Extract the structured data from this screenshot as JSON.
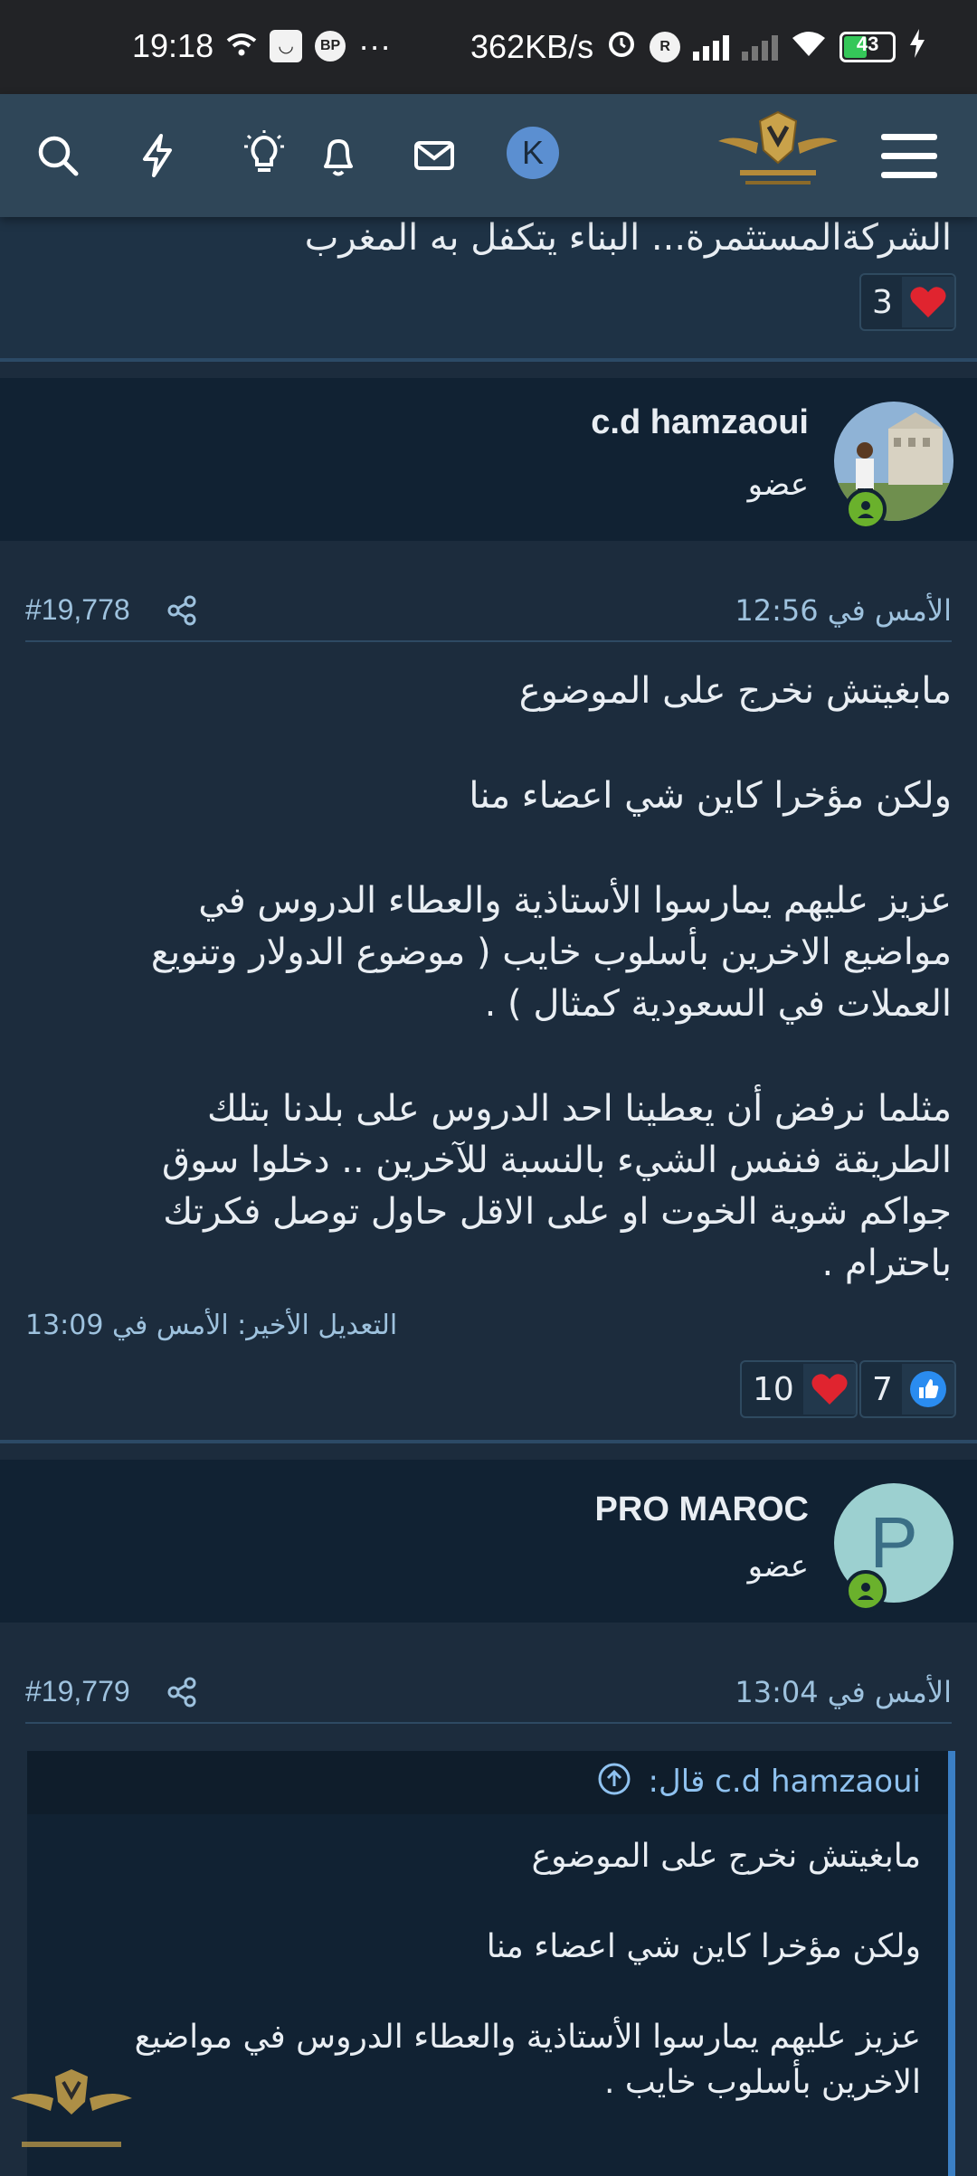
{
  "status_bar": {
    "time": "19:18",
    "bp": "BP",
    "dots": "···",
    "speed": "362KB/s",
    "r_icon": "R",
    "battery": "43"
  },
  "nav": {
    "avatar_letter": "K",
    "icons": [
      "search-icon",
      "lightning-icon",
      "lightbulb-icon",
      "bell-icon",
      "mail-icon",
      "menu-icon"
    ]
  },
  "prev_post": {
    "last_line": "الشركةالمستثمرة... البناء يتكفل به المغرب",
    "love_count": "3"
  },
  "post1": {
    "username": "c.d hamzaoui",
    "user_title": "عضو",
    "date": "الأمس في 12:56",
    "number": "#19,778",
    "lines": [
      "مابغيتش نخرج على الموضوع",
      "ولكن مؤخرا كاين شي اعضاء منا",
      "عزيز عليهم يمارسوا الأستاذية والعطاء الدروس في",
      "مواضيع الاخرين بأسلوب خايب ( موضوع الدولار وتنويع",
      "العملات في السعودية كمثال ) .",
      "مثلما نرفض أن يعطينا احد الدروس على بلدنا بتلك",
      "الطريقة فنفس الشيء بالنسبة للآخرين .. دخلوا سوق",
      "جواكم شوية الخوت او على الاقل حاول توصل فكرتك",
      "باحترام ."
    ],
    "edited": "التعديل الأخير: الأمس في 13:09",
    "like_count": "7",
    "love_count": "10"
  },
  "post2": {
    "username": "PRO MAROC",
    "avatar_letter": "P",
    "user_title": "عضو",
    "date": "الأمس في 13:04",
    "number": "#19,779",
    "quote_attribution": "c.d hamzaoui قال:",
    "quote_lines": [
      "مابغيتش نخرج على الموضوع",
      "ولكن مؤخرا كاين شي اعضاء منا",
      "عزيز عليهم يمارسوا الأستاذية والعطاء الدروس في مواضيع",
      "الاخرين بأسلوب خايب ."
    ]
  },
  "colors": {
    "accent": "#3b7fc4",
    "online": "#6ab12c",
    "heart": "#e0242f",
    "like": "#2a8cf0"
  }
}
